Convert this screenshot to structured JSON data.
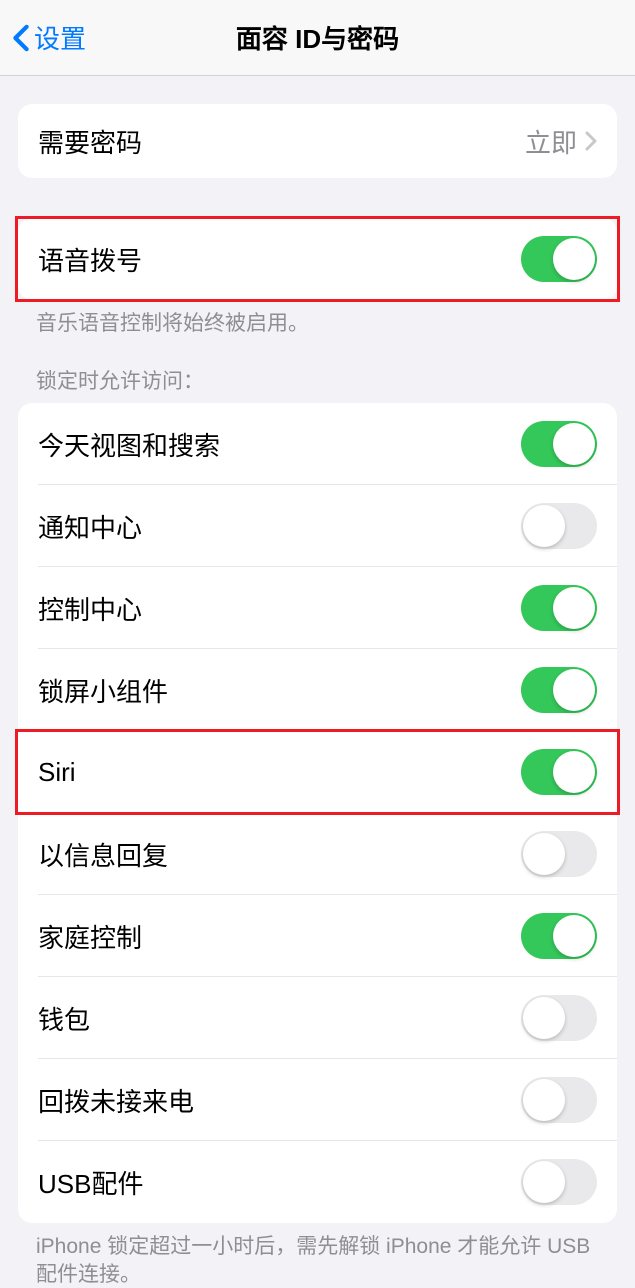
{
  "header": {
    "back_label": "设置",
    "title": "面容 ID与密码"
  },
  "password_row": {
    "label": "需要密码",
    "value": "立即"
  },
  "voice_dial": {
    "label": "语音拨号",
    "on": true,
    "footer": "音乐语音控制将始终被启用。"
  },
  "locked_access": {
    "header": "锁定时允许访问：",
    "items": [
      {
        "label": "今天视图和搜索",
        "on": true
      },
      {
        "label": "通知中心",
        "on": false
      },
      {
        "label": "控制中心",
        "on": true
      },
      {
        "label": "锁屏小组件",
        "on": true
      },
      {
        "label": "Siri",
        "on": true
      },
      {
        "label": "以信息回复",
        "on": false
      },
      {
        "label": "家庭控制",
        "on": true
      },
      {
        "label": "钱包",
        "on": false
      },
      {
        "label": "回拨未接来电",
        "on": false
      },
      {
        "label": "USB配件",
        "on": false
      }
    ],
    "footer": "iPhone 锁定超过一小时后，需先解锁 iPhone 才能允许 USB 配件连接。"
  }
}
